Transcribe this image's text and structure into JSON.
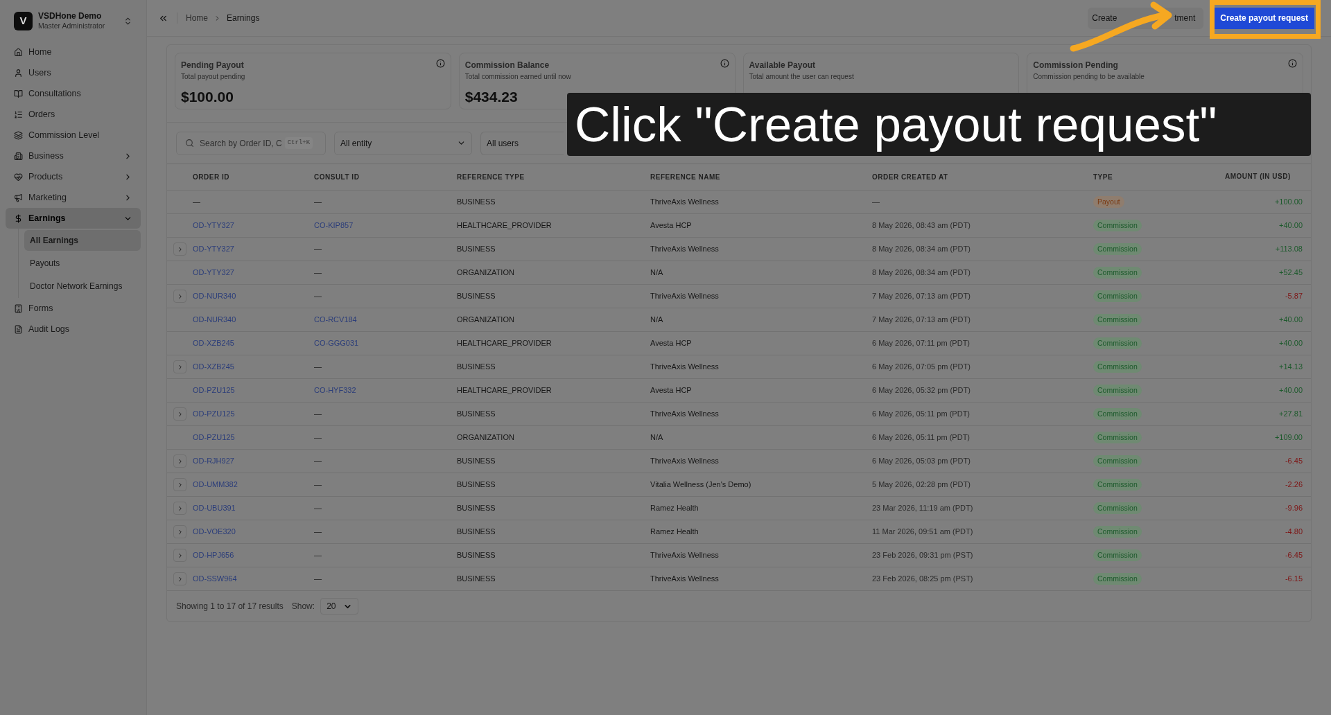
{
  "workspace": {
    "initial": "V",
    "name": "VSDHone Demo",
    "role": "Master Administrator"
  },
  "sidebar": {
    "items": [
      {
        "label": "Home",
        "expandable": false,
        "selected": false
      },
      {
        "label": "Users",
        "expandable": false,
        "selected": false
      },
      {
        "label": "Consultations",
        "expandable": false,
        "selected": false
      },
      {
        "label": "Orders",
        "expandable": false,
        "selected": false
      },
      {
        "label": "Commission Level",
        "expandable": false,
        "selected": false
      },
      {
        "label": "Business",
        "expandable": true,
        "expanded": false,
        "selected": false
      },
      {
        "label": "Products",
        "expandable": true,
        "expanded": false,
        "selected": false
      },
      {
        "label": "Marketing",
        "expandable": true,
        "expanded": false,
        "selected": false
      },
      {
        "label": "Earnings",
        "expandable": true,
        "expanded": true,
        "selected": true,
        "children": [
          {
            "label": "All Earnings",
            "selected": true
          },
          {
            "label": "Payouts",
            "selected": false
          },
          {
            "label": "Doctor Network Earnings",
            "selected": false
          }
        ]
      },
      {
        "label": "Forms",
        "expandable": false,
        "selected": false
      },
      {
        "label": "Audit Logs",
        "expandable": false,
        "selected": false
      }
    ]
  },
  "breadcrumb": [
    "Home",
    "Earnings"
  ],
  "header_buttons": {
    "secondary_visible_parts": [
      "Create",
      "tment"
    ],
    "primary": "Create payout request"
  },
  "cards": [
    {
      "title": "Pending Payout",
      "subtitle": "Total payout pending",
      "value": "$100.00",
      "info": true
    },
    {
      "title": "Commission Balance",
      "subtitle": "Total commission earned until now",
      "value": "$434.23",
      "info": true
    },
    {
      "title": "Available Payout",
      "subtitle": "Total amount the user can request",
      "info": false
    },
    {
      "title": "Commission Pending",
      "subtitle": "Commission pending to be available",
      "info": true
    }
  ],
  "filters": {
    "search_placeholder": "Search by Order ID, C",
    "shortcut": "Ctrl+K",
    "entity": "All entity",
    "users": "All users"
  },
  "table": {
    "columns": [
      "ORDER ID",
      "CONSULT ID",
      "REFERENCE TYPE",
      "REFERENCE NAME",
      "ORDER CREATED AT",
      "TYPE",
      "AMOUNT (IN USD)"
    ],
    "rows": [
      {
        "expandable": false,
        "order": {
          "text": "—",
          "kind": "plain"
        },
        "consult": {
          "text": "—",
          "kind": "plain"
        },
        "reference_type": "BUSINESS",
        "reference_name": "ThriveAxis Wellness",
        "created_at": "—",
        "type": {
          "label": "Payout",
          "kind": "payout"
        },
        "amount": "+100.00",
        "color": "#1d5a2c"
      },
      {
        "expandable": false,
        "order": {
          "text": "OD-YTY327",
          "kind": "link"
        },
        "consult": {
          "text": "CO-KIP857",
          "kind": "link"
        },
        "reference_type": "HEALTHCARE_PROVIDER",
        "reference_name": "Avesta HCP",
        "created_at": "8 May 2026, 08:43 am (PDT)",
        "type": {
          "label": "Commission",
          "kind": "commission"
        },
        "amount": "+40.00",
        "color": "#1d5a2c"
      },
      {
        "expandable": true,
        "order": {
          "text": "OD-YTY327",
          "kind": "link"
        },
        "consult": {
          "text": "—",
          "kind": "plain"
        },
        "reference_type": "BUSINESS",
        "reference_name": "ThriveAxis Wellness",
        "created_at": "8 May 2026, 08:34 am (PDT)",
        "type": {
          "label": "Commission",
          "kind": "commission"
        },
        "amount": "+113.08",
        "color": "#1d5a2c"
      },
      {
        "expandable": false,
        "order": {
          "text": "OD-YTY327",
          "kind": "link"
        },
        "consult": {
          "text": "—",
          "kind": "plain"
        },
        "reference_type": "ORGANIZATION",
        "reference_name": "N/A",
        "created_at": "8 May 2026, 08:34 am (PDT)",
        "type": {
          "label": "Commission",
          "kind": "commission"
        },
        "amount": "+52.45",
        "color": "#1d5a2c"
      },
      {
        "expandable": true,
        "order": {
          "text": "OD-NUR340",
          "kind": "link"
        },
        "consult": {
          "text": "—",
          "kind": "plain"
        },
        "reference_type": "BUSINESS",
        "reference_name": "ThriveAxis Wellness",
        "created_at": "7 May 2026, 07:13 am (PDT)",
        "type": {
          "label": "Commission",
          "kind": "commission"
        },
        "amount": "-5.87",
        "color": "#7e1515"
      },
      {
        "expandable": false,
        "order": {
          "text": "OD-NUR340",
          "kind": "link"
        },
        "consult": {
          "text": "CO-RCV184",
          "kind": "link"
        },
        "reference_type": "ORGANIZATION",
        "reference_name": "N/A",
        "created_at": "7 May 2026, 07:13 am (PDT)",
        "type": {
          "label": "Commission",
          "kind": "commission"
        },
        "amount": "+40.00",
        "color": "#1d5a2c"
      },
      {
        "expandable": false,
        "order": {
          "text": "OD-XZB245",
          "kind": "link"
        },
        "consult": {
          "text": "CO-GGG031",
          "kind": "link"
        },
        "reference_type": "HEALTHCARE_PROVIDER",
        "reference_name": "Avesta HCP",
        "created_at": "6 May 2026, 07:11 pm (PDT)",
        "type": {
          "label": "Commission",
          "kind": "commission"
        },
        "amount": "+40.00",
        "color": "#1d5a2c"
      },
      {
        "expandable": true,
        "order": {
          "text": "OD-XZB245",
          "kind": "link"
        },
        "consult": {
          "text": "—",
          "kind": "plain"
        },
        "reference_type": "BUSINESS",
        "reference_name": "ThriveAxis Wellness",
        "created_at": "6 May 2026, 07:05 pm (PDT)",
        "type": {
          "label": "Commission",
          "kind": "commission"
        },
        "amount": "+14.13",
        "color": "#1d5a2c"
      },
      {
        "expandable": false,
        "order": {
          "text": "OD-PZU125",
          "kind": "link"
        },
        "consult": {
          "text": "CO-HYF332",
          "kind": "link"
        },
        "reference_type": "HEALTHCARE_PROVIDER",
        "reference_name": "Avesta HCP",
        "created_at": "6 May 2026, 05:32 pm (PDT)",
        "type": {
          "label": "Commission",
          "kind": "commission"
        },
        "amount": "+40.00",
        "color": "#1d5a2c"
      },
      {
        "expandable": true,
        "order": {
          "text": "OD-PZU125",
          "kind": "link"
        },
        "consult": {
          "text": "—",
          "kind": "plain"
        },
        "reference_type": "BUSINESS",
        "reference_name": "ThriveAxis Wellness",
        "created_at": "6 May 2026, 05:11 pm (PDT)",
        "type": {
          "label": "Commission",
          "kind": "commission"
        },
        "amount": "+27.81",
        "color": "#1d5a2c"
      },
      {
        "expandable": false,
        "order": {
          "text": "OD-PZU125",
          "kind": "link"
        },
        "consult": {
          "text": "—",
          "kind": "plain"
        },
        "reference_type": "ORGANIZATION",
        "reference_name": "N/A",
        "created_at": "6 May 2026, 05:11 pm (PDT)",
        "type": {
          "label": "Commission",
          "kind": "commission"
        },
        "amount": "+109.00",
        "color": "#1d5a2c"
      },
      {
        "expandable": true,
        "order": {
          "text": "OD-RJH927",
          "kind": "link"
        },
        "consult": {
          "text": "—",
          "kind": "plain"
        },
        "reference_type": "BUSINESS",
        "reference_name": "ThriveAxis Wellness",
        "created_at": "6 May 2026, 05:03 pm (PDT)",
        "type": {
          "label": "Commission",
          "kind": "commission"
        },
        "amount": "-6.45",
        "color": "#7e1515"
      },
      {
        "expandable": true,
        "order": {
          "text": "OD-UMM382",
          "kind": "link"
        },
        "consult": {
          "text": "—",
          "kind": "plain"
        },
        "reference_type": "BUSINESS",
        "reference_name": "Vitalia Wellness (Jen's Demo)",
        "created_at": "5 May 2026, 02:28 pm (PDT)",
        "type": {
          "label": "Commission",
          "kind": "commission"
        },
        "amount": "-2.26",
        "color": "#7e1515"
      },
      {
        "expandable": true,
        "order": {
          "text": "OD-UBU391",
          "kind": "link"
        },
        "consult": {
          "text": "—",
          "kind": "plain"
        },
        "reference_type": "BUSINESS",
        "reference_name": "Ramez Health",
        "created_at": "23 Mar 2026, 11:19 am (PDT)",
        "type": {
          "label": "Commission",
          "kind": "commission"
        },
        "amount": "-9.96",
        "color": "#7e1515"
      },
      {
        "expandable": true,
        "order": {
          "text": "OD-VOE320",
          "kind": "link"
        },
        "consult": {
          "text": "—",
          "kind": "plain"
        },
        "reference_type": "BUSINESS",
        "reference_name": "Ramez Health",
        "created_at": "11 Mar 2026, 09:51 am (PDT)",
        "type": {
          "label": "Commission",
          "kind": "commission"
        },
        "amount": "-4.80",
        "color": "#7e1515"
      },
      {
        "expandable": true,
        "order": {
          "text": "OD-HPJ656",
          "kind": "link"
        },
        "consult": {
          "text": "—",
          "kind": "plain"
        },
        "reference_type": "BUSINESS",
        "reference_name": "ThriveAxis Wellness",
        "created_at": "23 Feb 2026, 09:31 pm (PST)",
        "type": {
          "label": "Commission",
          "kind": "commission"
        },
        "amount": "-6.45",
        "color": "#7e1515"
      },
      {
        "expandable": true,
        "order": {
          "text": "OD-SSW964",
          "kind": "link"
        },
        "consult": {
          "text": "—",
          "kind": "plain"
        },
        "reference_type": "BUSINESS",
        "reference_name": "ThriveAxis Wellness",
        "created_at": "23 Feb 2026, 08:25 pm (PST)",
        "type": {
          "label": "Commission",
          "kind": "commission"
        },
        "amount": "-6.15",
        "color": "#7e1515"
      }
    ]
  },
  "pagination": {
    "summary": "Showing 1 to 17 of 17 results",
    "show_label": "Show:",
    "page_size": "20"
  },
  "caption": "Click \"Create payout request\""
}
